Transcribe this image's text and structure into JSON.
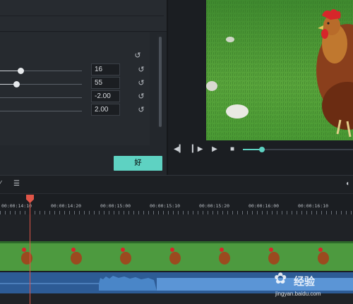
{
  "settings": {
    "rows": [
      {
        "value": "16",
        "fill": 0.25
      },
      {
        "value": "55",
        "fill": 0.2
      },
      {
        "value": "-2.00",
        "fill": null
      },
      {
        "value": "2.00",
        "fill": null
      }
    ],
    "ok_label": "好"
  },
  "preview": {
    "progress": 0.17
  },
  "timeline": {
    "ticks": [
      "00:00:14:10",
      "00:00:14:20",
      "00:00:15:00",
      "00:00:15:10",
      "00:00:15:20",
      "00:00:16:00",
      "00:00:16:10"
    ]
  },
  "watermark": {
    "main": "经验",
    "sub": "jingyan.baidu.com"
  },
  "colors": {
    "accent": "#5ed2c2",
    "playhead": "#e05548",
    "video_track": "#3d8a3b",
    "audio_track": "#2d5b95"
  }
}
